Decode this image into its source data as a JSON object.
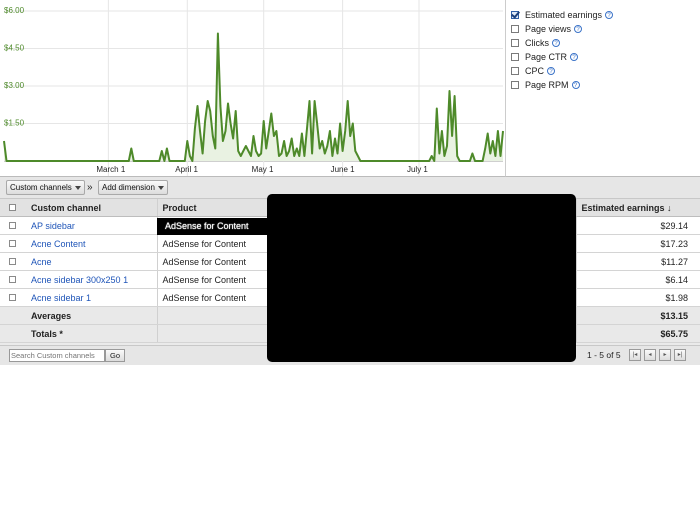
{
  "chart_data": {
    "type": "line",
    "y_tick_labels": [
      "$6.00",
      "$4.50",
      "$3.00",
      "$1.50"
    ],
    "ylim": [
      0,
      6
    ],
    "x_tick_labels": [
      "March 1",
      "April 1",
      "May 1",
      "June 1",
      "July 1"
    ],
    "series": [
      {
        "color": "#4e8a2a",
        "values": [
          0.8,
          0,
          0,
          0,
          0,
          0,
          0,
          0,
          0,
          0,
          0,
          0,
          0,
          0,
          0,
          0,
          0,
          0,
          0,
          0,
          0,
          0,
          0,
          0,
          0,
          0,
          0,
          0,
          0,
          0,
          0,
          0,
          0,
          0,
          0,
          0,
          0,
          0,
          0,
          0,
          0,
          0,
          0,
          0,
          0,
          0,
          0,
          0,
          0,
          0,
          0.5,
          0,
          0,
          0,
          0,
          0,
          0,
          0,
          0,
          0,
          0,
          0,
          0.4,
          0,
          0.5,
          0,
          0,
          0,
          0,
          0,
          0,
          0,
          0.8,
          0.2,
          0,
          1.3,
          2.2,
          1.2,
          0.3,
          1.6,
          2.4,
          2.0,
          1.0,
          0.5,
          5.1,
          2.2,
          0.8,
          1.2,
          2.3,
          1.5,
          0.9,
          2.0,
          0.4,
          0.2,
          0.4,
          0.6,
          0.4,
          0.2,
          1.0,
          0.4,
          0.2,
          0.3,
          1.6,
          0.5,
          1.2,
          1.9,
          1.0,
          1.2,
          0.2,
          0.3,
          0.8,
          0.2,
          0.4,
          0.9,
          0.2,
          0.5,
          0.2,
          1.1,
          0.2,
          1.3,
          2.4,
          0.3,
          2.4,
          1.5,
          0.5,
          0.8,
          0.3,
          0.6,
          1.2,
          0.2,
          0.9,
          0.3,
          1.5,
          0.4,
          1.2,
          2.4,
          1.0,
          1.5,
          0.4,
          0.2,
          0,
          0,
          0,
          0,
          0,
          0,
          0,
          0,
          0,
          0,
          0,
          0,
          0,
          0,
          0,
          0,
          0,
          0,
          0,
          0,
          0,
          0,
          0,
          0,
          0,
          0,
          0,
          0,
          0.2,
          0,
          2.1,
          0.3,
          1.2,
          0.2,
          0.6,
          2.8,
          1.0,
          2.6,
          0.2,
          0,
          0,
          0,
          0,
          0,
          0.3,
          0,
          0,
          0,
          0,
          0.5,
          1.1,
          0.3,
          0.8,
          0.2,
          1.2,
          0.2,
          1.2
        ]
      }
    ]
  },
  "legend": {
    "items": [
      {
        "label": "Estimated earnings",
        "checked": true
      },
      {
        "label": "Page views",
        "checked": false
      },
      {
        "label": "Clicks",
        "checked": false
      },
      {
        "label": "Page CTR",
        "checked": false
      },
      {
        "label": "CPC",
        "checked": false
      },
      {
        "label": "Page RPM",
        "checked": false
      }
    ],
    "help_glyph": "?"
  },
  "toolbar": {
    "custom_channels_label": "Custom channels",
    "separator": "»",
    "add_dimension_label": "Add dimension"
  },
  "table": {
    "headers": {
      "custom_channel": "Custom channel",
      "product": "Product",
      "estimated_earnings": "Estimated earnings ↓"
    },
    "rows": [
      {
        "channel": "AP sidebar",
        "product": "AdSense for Content",
        "earnings": "$29.14"
      },
      {
        "channel": "Acne Content",
        "product": "AdSense for Content",
        "earnings": "$17.23"
      },
      {
        "channel": "Acne",
        "product": "AdSense for Content",
        "earnings": "$11.27"
      },
      {
        "channel": "Acne sidebar 300x250 1",
        "product": "AdSense for Content",
        "earnings": "$6.14"
      },
      {
        "channel": "Acne sidebar 1",
        "product": "AdSense for Content",
        "earnings": "$1.98"
      }
    ],
    "averages": {
      "label": "Averages",
      "earnings": "$13.15"
    },
    "totals": {
      "label": "Totals *",
      "earnings": "$65.75"
    }
  },
  "footer": {
    "search_placeholder": "Search Custom channels",
    "go_label": "Go",
    "pager_text": "1 - 5 of 5",
    "pager_buttons": [
      "|◂",
      "◂",
      "▸",
      "▸|"
    ]
  }
}
